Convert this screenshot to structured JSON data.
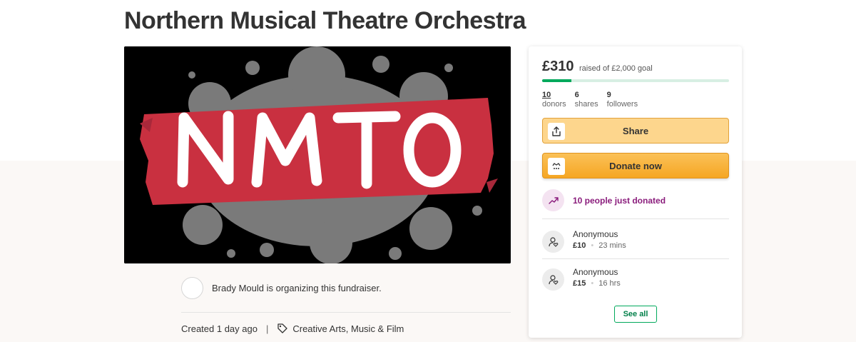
{
  "title": "Northern Musical Theatre Orchestra",
  "hero_image": {
    "logo_text": "NMTO"
  },
  "organizer": {
    "text": "Brady Mould is organizing this fundraiser."
  },
  "meta": {
    "created": "Created 1 day ago",
    "category": "Creative Arts, Music & Film"
  },
  "stats_card": {
    "raised": "£310",
    "raised_of": "raised of £2,000 goal",
    "progress_fraction": 0.155,
    "stats": [
      {
        "num": "10",
        "label": "donors"
      },
      {
        "num": "6",
        "label": "shares"
      },
      {
        "num": "9",
        "label": "followers"
      }
    ],
    "share_label": "Share",
    "donate_label": "Donate now",
    "trend_text": "10 people just donated",
    "donations": [
      {
        "name": "Anonymous",
        "amount": "£10",
        "time": "23 mins"
      },
      {
        "name": "Anonymous",
        "amount": "£15",
        "time": "16 hrs"
      }
    ],
    "see_all_label": "See all"
  },
  "colors": {
    "accent_green": "#02a95c",
    "donate_orange": "#f5a623",
    "trend_purple": "#8a1c7c",
    "hero_red": "#c93040"
  },
  "icons": [
    "share-upload-icon",
    "gofundme-logo-icon",
    "trend-up-icon",
    "user-heart-icon",
    "tag-icon"
  ]
}
